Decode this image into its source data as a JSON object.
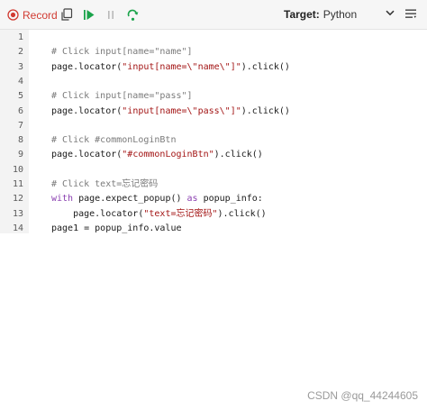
{
  "toolbar": {
    "record_label": "Record",
    "target_label": "Target:",
    "target_value": "Python"
  },
  "colors": {
    "record": "#d13b32",
    "play": "#1aa34a",
    "comment": "#7a7a7a",
    "string": "#a31515",
    "keyword": "#8a3fb0"
  },
  "icons": [
    "record-icon",
    "copy-icon",
    "play-icon",
    "pause-icon",
    "step-icon",
    "chevron-down-icon",
    "menu-icon"
  ],
  "code": {
    "lines": [
      {
        "num": "1",
        "parts": []
      },
      {
        "num": "2",
        "parts": [
          {
            "t": "comment",
            "s": "# Click input[name=\"name\"]"
          }
        ]
      },
      {
        "num": "3",
        "parts": [
          {
            "t": "plain",
            "s": "page.locator("
          },
          {
            "t": "str",
            "s": "\"input[name=\\\"name\\\"]\""
          },
          {
            "t": "plain",
            "s": ").click()"
          }
        ]
      },
      {
        "num": "4",
        "parts": []
      },
      {
        "num": "5",
        "parts": [
          {
            "t": "comment",
            "s": "# Click input[name=\"pass\"]"
          }
        ]
      },
      {
        "num": "6",
        "parts": [
          {
            "t": "plain",
            "s": "page.locator("
          },
          {
            "t": "str",
            "s": "\"input[name=\\\"pass\\\"]\""
          },
          {
            "t": "plain",
            "s": ").click()"
          }
        ]
      },
      {
        "num": "7",
        "parts": []
      },
      {
        "num": "8",
        "parts": [
          {
            "t": "comment",
            "s": "# Click #commonLoginBtn"
          }
        ]
      },
      {
        "num": "9",
        "parts": [
          {
            "t": "plain",
            "s": "page.locator("
          },
          {
            "t": "str",
            "s": "\"#commonLoginBtn\""
          },
          {
            "t": "plain",
            "s": ").click()"
          }
        ]
      },
      {
        "num": "10",
        "parts": []
      },
      {
        "num": "11",
        "parts": [
          {
            "t": "comment",
            "s": "# Click text=忘记密码"
          }
        ]
      },
      {
        "num": "12",
        "parts": [
          {
            "t": "kw",
            "s": "with"
          },
          {
            "t": "plain",
            "s": " page.expect_popup() "
          },
          {
            "t": "kw",
            "s": "as"
          },
          {
            "t": "plain",
            "s": " popup_info:"
          }
        ]
      },
      {
        "num": "13",
        "parts": [
          {
            "t": "plain",
            "s": "    page.locator("
          },
          {
            "t": "str",
            "s": "\"text=忘记密码\""
          },
          {
            "t": "plain",
            "s": ").click()"
          }
        ]
      },
      {
        "num": "14",
        "parts": [
          {
            "t": "plain",
            "s": "page1 = popup_info.value"
          }
        ]
      }
    ]
  },
  "watermark": "CSDN @qq_44244605"
}
